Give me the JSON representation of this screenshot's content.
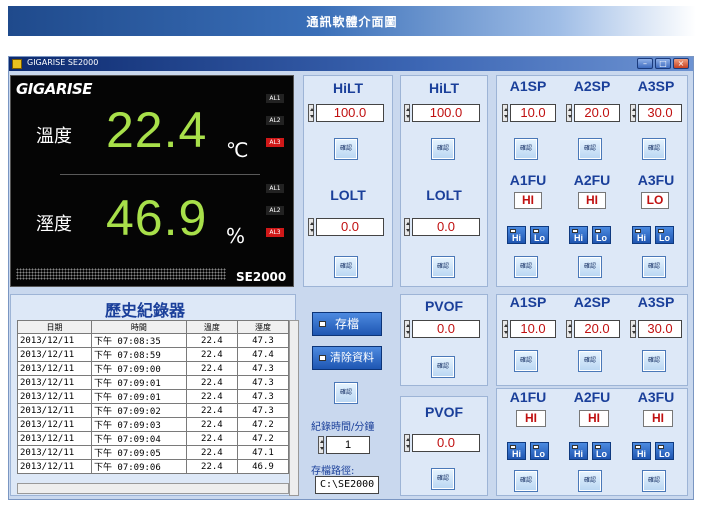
{
  "banner": {
    "title": "通訊軟體介面圖"
  },
  "window": {
    "title": "GIGARISE   SE2000",
    "min": "–",
    "max": "□",
    "close": "×"
  },
  "display": {
    "logo": "GIGARISE",
    "temp_label": "溫度",
    "temp_value": "22.4",
    "temp_unit": "℃",
    "hum_label": "溼度",
    "hum_value": "46.9",
    "hum_unit": "%",
    "alarms": [
      "AL1",
      "AL2",
      "AL3"
    ],
    "model": "SE2000"
  },
  "hilt1": {
    "label": "HiLT",
    "value": "100.0",
    "ok": "確認"
  },
  "lolt1": {
    "label": "LOLT",
    "value": "0.0",
    "ok": "確認"
  },
  "hilt2": {
    "label": "HiLT",
    "value": "100.0",
    "ok": "確認"
  },
  "lolt2": {
    "label": "LOLT",
    "value": "0.0",
    "ok": "確認"
  },
  "pvof1": {
    "label": "PVOF",
    "value": "0.0",
    "ok": "確認"
  },
  "pvof2": {
    "label": "PVOF",
    "value": "0.0",
    "ok": "確認"
  },
  "sp1": {
    "labels": [
      "A1SP",
      "A2SP",
      "A3SP"
    ],
    "values": [
      "10.0",
      "20.0",
      "30.0"
    ],
    "ok": "確認"
  },
  "fu1": {
    "labels": [
      "A1FU",
      "A2FU",
      "A3FU"
    ],
    "values": [
      "HI",
      "HI",
      "LO"
    ],
    "hi": "Hi",
    "lo": "Lo",
    "ok": "確認"
  },
  "sp2": {
    "labels": [
      "A1SP",
      "A2SP",
      "A3SP"
    ],
    "values": [
      "10.0",
      "20.0",
      "30.0"
    ],
    "ok": "確認"
  },
  "fu2": {
    "labels": [
      "A1FU",
      "A2FU",
      "A3FU"
    ],
    "values": [
      "HI",
      "HI",
      "HI"
    ],
    "hi": "Hi",
    "lo": "Lo",
    "ok": "確認"
  },
  "history": {
    "title": "歷史紀錄器",
    "columns": [
      "日期",
      "時間",
      "溫度",
      "溼度"
    ],
    "rows": [
      [
        "2013/12/11",
        "下午 07:08:35",
        "22.4",
        "47.3"
      ],
      [
        "2013/12/11",
        "下午 07:08:59",
        "22.4",
        "47.4"
      ],
      [
        "2013/12/11",
        "下午 07:09:00",
        "22.4",
        "47.3"
      ],
      [
        "2013/12/11",
        "下午 07:09:01",
        "22.4",
        "47.3"
      ],
      [
        "2013/12/11",
        "下午 07:09:01",
        "22.4",
        "47.3"
      ],
      [
        "2013/12/11",
        "下午 07:09:02",
        "22.4",
        "47.3"
      ],
      [
        "2013/12/11",
        "下午 07:09:03",
        "22.4",
        "47.2"
      ],
      [
        "2013/12/11",
        "下午 07:09:04",
        "22.4",
        "47.2"
      ],
      [
        "2013/12/11",
        "下午 07:09:05",
        "22.4",
        "47.1"
      ],
      [
        "2013/12/11",
        "下午 07:09:06",
        "22.4",
        "46.9"
      ]
    ],
    "save": "存檔",
    "clear": "清除資料",
    "ok": "確認",
    "interval_label": "紀錄時間/分鐘",
    "interval_value": "1",
    "path_label": "存檔路徑:",
    "path_value": "C:\\SE2000"
  }
}
